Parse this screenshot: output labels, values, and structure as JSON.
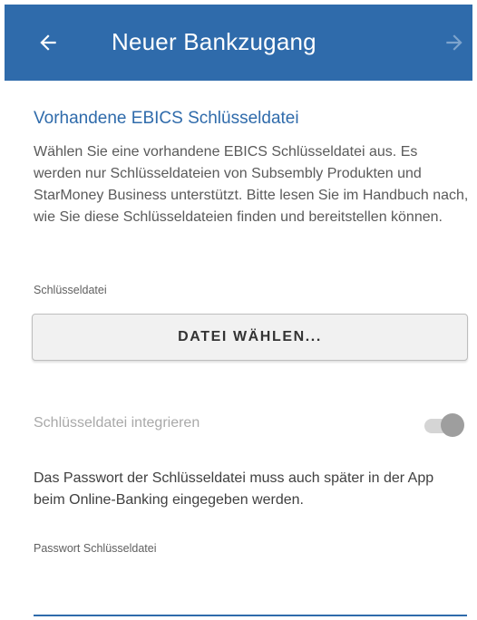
{
  "appbar": {
    "title": "Neuer Bankzugang",
    "back_icon": "arrow-left-icon",
    "next_icon": "arrow-right-icon",
    "color": "#2f6bab"
  },
  "section": {
    "title": "Vorhandene EBICS Schlüsseldatei",
    "description": "Wählen Sie eine vorhandene EBICS Schlüsseldatei aus. Es werden nur Schlüsseldateien von Subsembly Produkten und StarMoney Business unterstützt. Bitte lesen Sie im Handbuch nach, wie Sie diese Schlüsseldateien finden und bereitstellen können."
  },
  "file": {
    "label": "Schlüsseldatei",
    "button_label": "DATEI WÄHLEN..."
  },
  "integrate": {
    "label": "Schlüsseldatei integrieren",
    "enabled": false
  },
  "password": {
    "info": "Das Passwort der Schlüsseldatei muss auch später in der App beim Online-Banking eingegeben werden.",
    "label": "Passwort Schlüsseldatei",
    "value": ""
  }
}
